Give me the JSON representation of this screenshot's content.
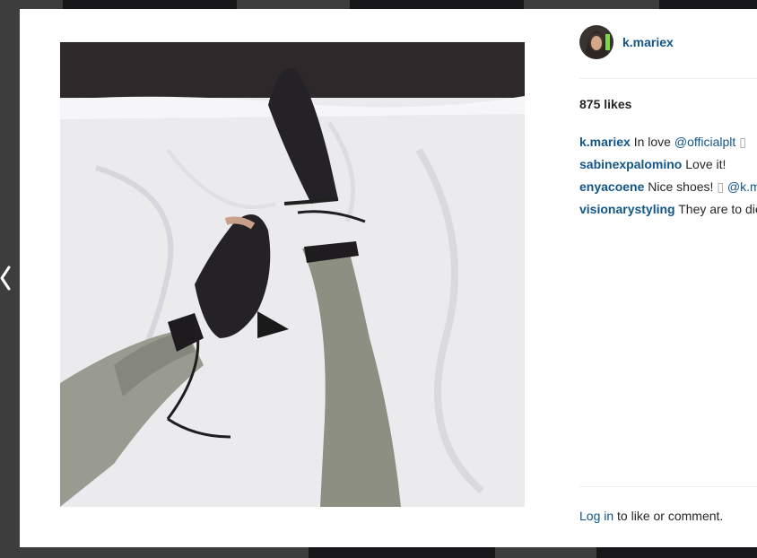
{
  "post": {
    "username": "k.mariex",
    "likes": "875 likes",
    "comments": [
      {
        "user": "k.mariex",
        "text": "In love",
        "mention": "@officialplt",
        "glyph": "▯"
      },
      {
        "user": "sabinexpalomino",
        "text": "Love it!",
        "mention": "",
        "glyph": ""
      },
      {
        "user": "enyacoene",
        "text": "Nice shoes!",
        "glyph": "▯",
        "mention": "@k.m"
      },
      {
        "user": "visionarystyling",
        "text": "They are to die",
        "mention": "",
        "glyph": ""
      }
    ],
    "login": {
      "link": "Log in",
      "text": "to like or comment."
    }
  },
  "colors": {
    "link": "#125688",
    "text": "#262626",
    "divider": "#efefef",
    "backdrop": "#6f6f6f"
  },
  "icons": {
    "prev": "chevron-left-icon"
  }
}
